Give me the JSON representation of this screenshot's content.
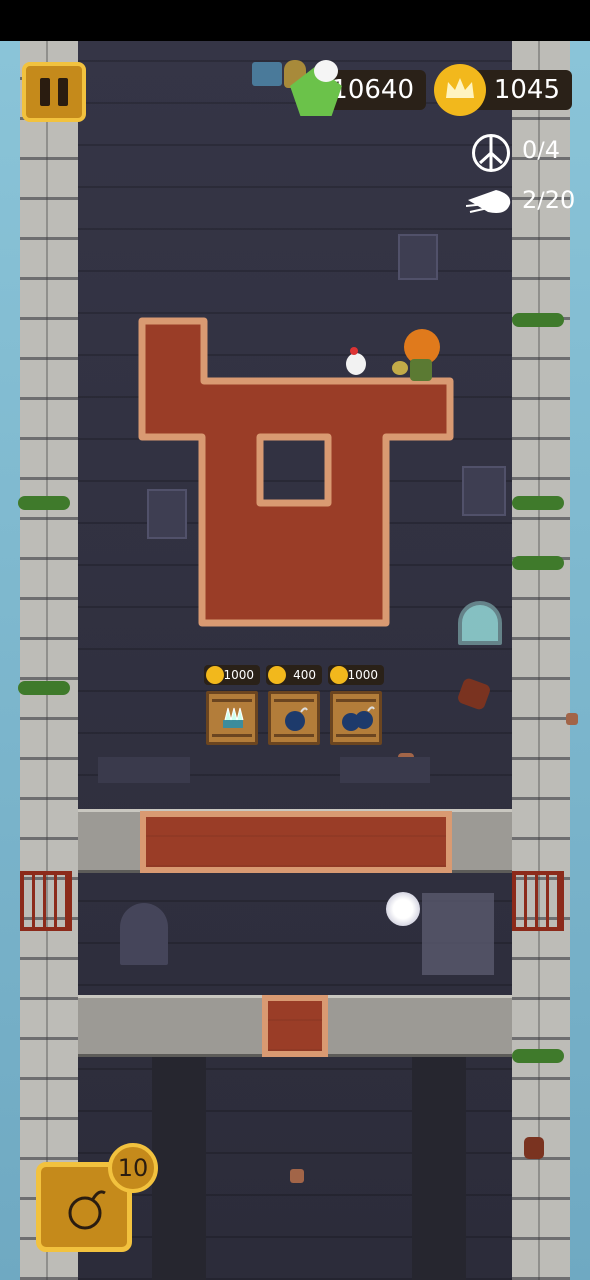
{
  "hud": {
    "score": "10640",
    "crowns": "1045",
    "peace_count": "0",
    "peace_total": "4",
    "dash_count": "2",
    "dash_total": "20"
  },
  "shop": {
    "items": [
      {
        "name": "spike-trap",
        "price": "1000"
      },
      {
        "name": "bomb",
        "price": "400"
      },
      {
        "name": "double-bomb",
        "price": "1000"
      }
    ]
  },
  "bomb_button": {
    "count": "10"
  },
  "colors": {
    "brick": "#9a3d27",
    "brick_border": "#d99a72",
    "gold": "#f2c23e",
    "button": "#c58a1b",
    "hud_bg": "#2a2118",
    "score_badge": "#6bc24a",
    "wall": "#2f2f3f"
  }
}
